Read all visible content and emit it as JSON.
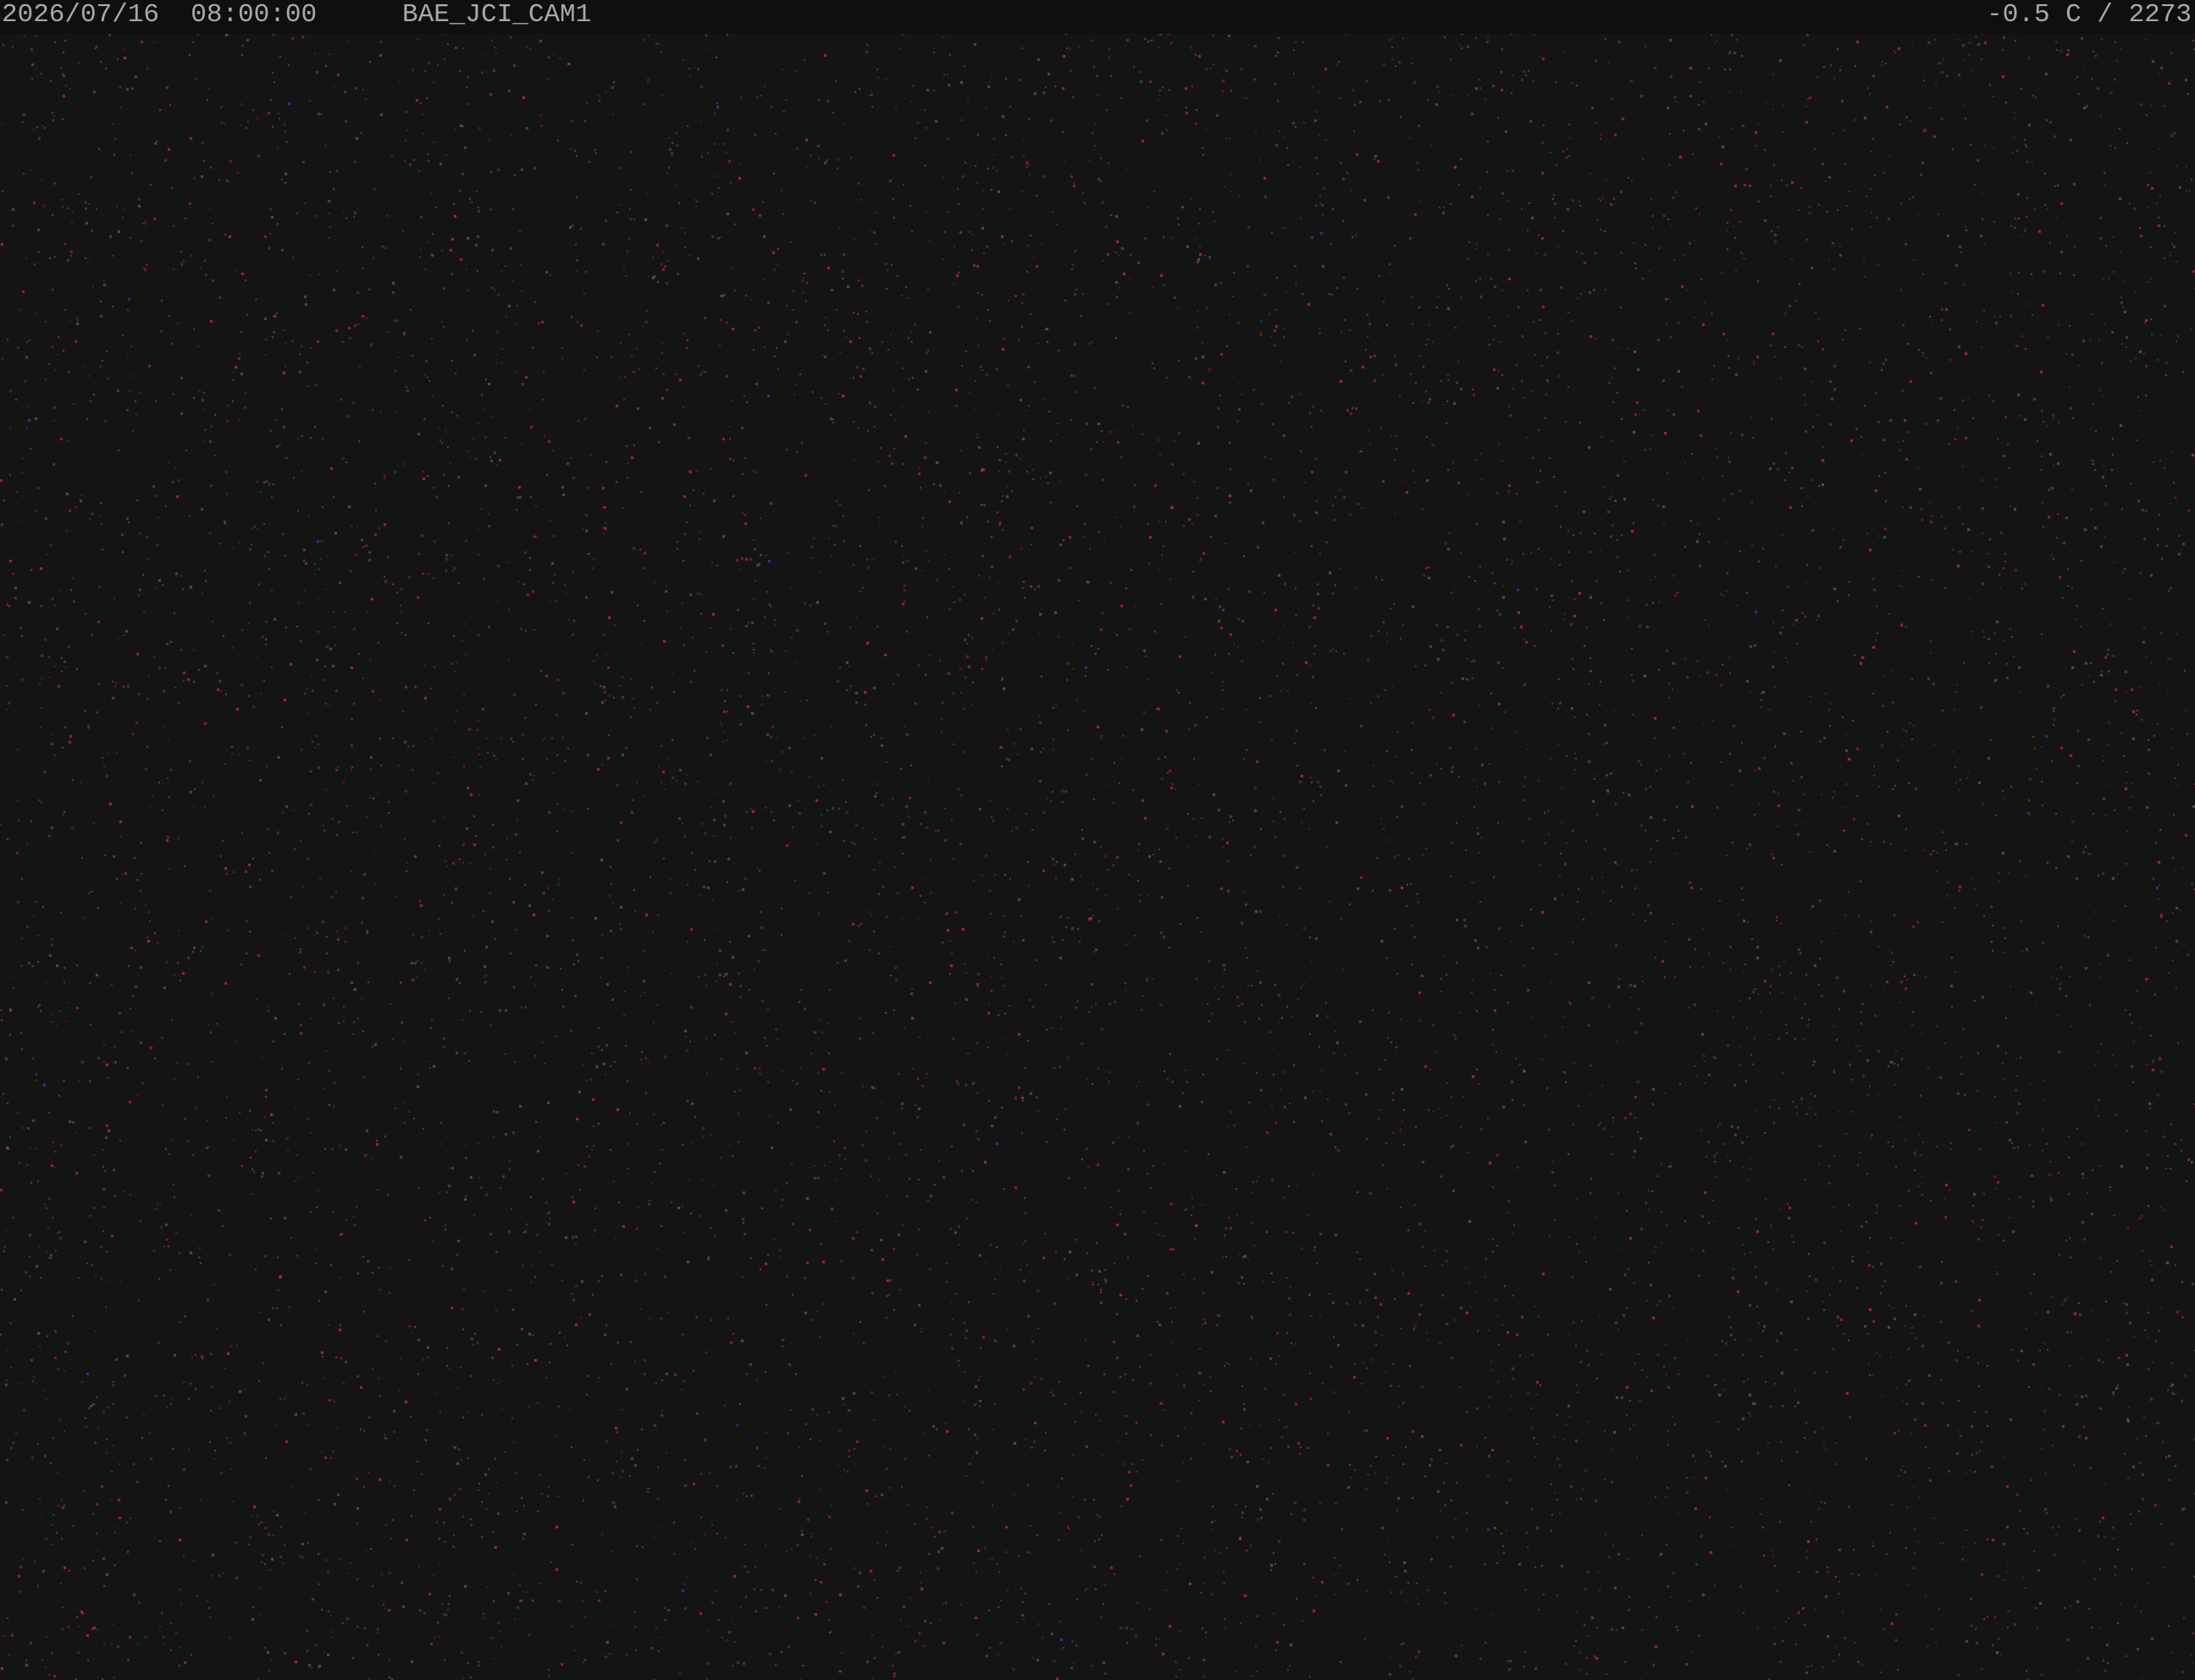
{
  "overlay": {
    "datetime": "2026/07/16  08:00:00",
    "camera_id": "BAE_JCI_CAM1",
    "sensor_readout": "-0.5 C / 2273"
  },
  "colors": {
    "background": "#141415",
    "overlay_background": "#0f0f10",
    "overlay_text": "#a9a9a9",
    "noise_red": "#b2323c",
    "noise_gray": "#5a5a5a",
    "noise_blue": "#3c3c96"
  }
}
